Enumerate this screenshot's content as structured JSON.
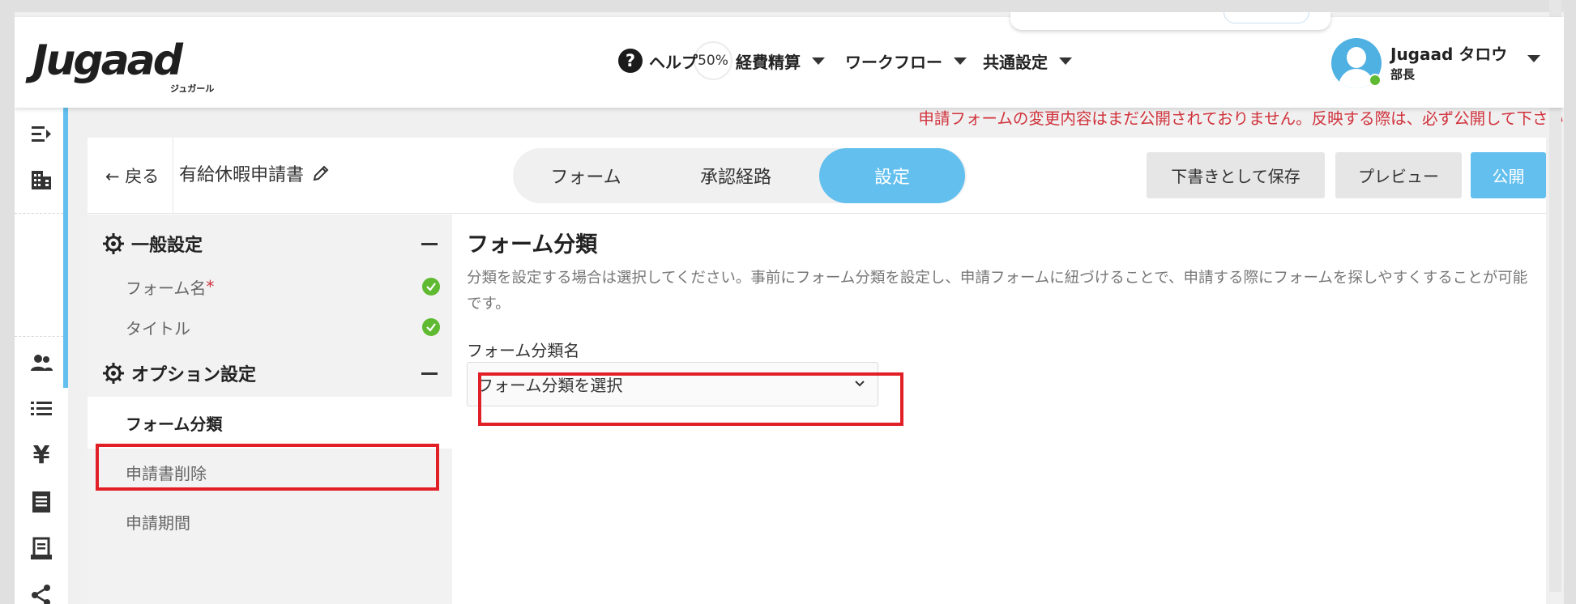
{
  "header": {
    "logo": {
      "text": "Jugaad",
      "subtitle": "ジュガール"
    },
    "zoom": "50%",
    "nav": [
      {
        "label": "ヘルプ",
        "icon": "help-icon"
      },
      {
        "label": "経費精算",
        "icon": "chevron-down-icon"
      },
      {
        "label": "ワークフロー",
        "icon": "chevron-down-icon"
      },
      {
        "label": "共通設定",
        "icon": "chevron-down-icon"
      }
    ],
    "user": {
      "name": "Jugaad タロウ",
      "role": "部長",
      "status_color": "#5fba32"
    }
  },
  "sidebar": {
    "icons": [
      "menu-collapse-icon",
      "building-icon",
      "users-icon",
      "list-icon",
      "yen-icon",
      "receipt-icon",
      "document-icon",
      "share-icon"
    ],
    "yen_glyph": "¥",
    "accent_color": "#62bfee"
  },
  "warning": "申請フォームの変更内容はまだ公開されておりません。反映する際は、必ず公開して下さい",
  "editor": {
    "back_label": "戻る",
    "form_title": "有給休暇申請書",
    "tabs": [
      {
        "label": "フォーム",
        "active": false
      },
      {
        "label": "承認経路",
        "active": false
      },
      {
        "label": "設定",
        "active": true
      }
    ],
    "buttons": {
      "save_draft": "下書きとして保存",
      "preview": "プレビュー",
      "publish": "公開"
    }
  },
  "settings_panel": {
    "sections": [
      {
        "title": "一般設定",
        "items": [
          {
            "label": "フォーム名",
            "required_mark": "*",
            "complete": true
          },
          {
            "label": "タイトル",
            "complete": true
          }
        ]
      },
      {
        "title": "オプション設定",
        "items": [
          {
            "label": "フォーム分類",
            "selected": true
          },
          {
            "label": "申請書削除"
          },
          {
            "label": "申請期間"
          }
        ]
      }
    ]
  },
  "main": {
    "title": "フォーム分類",
    "description": "分類を設定する場合は選択してください。事前にフォーム分類を設定し、申請フォームに紐づけることで、申請する際にフォームを探しやすくすることが可能です。",
    "field_label": "フォーム分類名",
    "select_value": "フォーム分類を選択"
  },
  "colors": {
    "accent": "#62bfee",
    "warning": "#d0323c",
    "highlight": "#e11f26",
    "success": "#5fba32"
  }
}
